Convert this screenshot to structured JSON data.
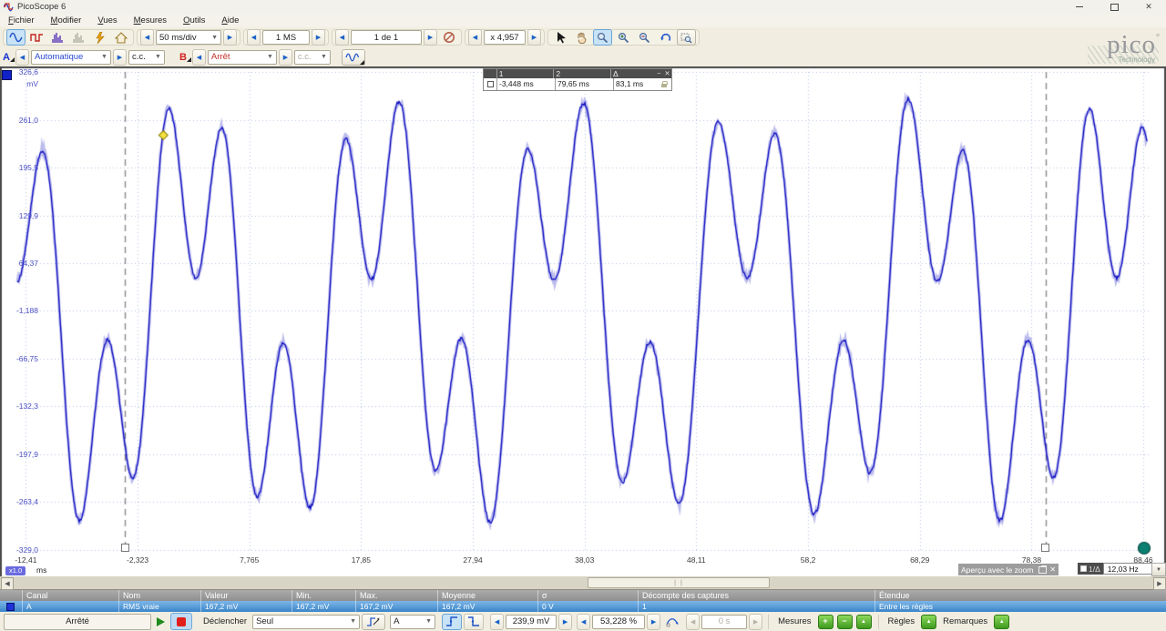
{
  "window": {
    "title": "PicoScope 6"
  },
  "menu": {
    "items": [
      "Fichier",
      "Modifier",
      "Vues",
      "Mesures",
      "Outils",
      "Aide"
    ]
  },
  "toolbar": {
    "timebase": "50 ms/div",
    "sample_count": "1 MS",
    "buffer_position": "1 de 1",
    "zoom_factor": "x 4,957"
  },
  "channel_bar": {
    "a_label": "A",
    "a_range": "Automatique",
    "a_coupling": "c.c.",
    "b_label": "B",
    "b_range": "Arrêt",
    "b_coupling": "c.c."
  },
  "logo": {
    "brand": "pico",
    "sub": "Technology"
  },
  "scope": {
    "y_axis_unit": "mV",
    "x_axis_unit": "ms",
    "x_scale_badge": "x1.0",
    "ruler_legend": {
      "headers": [
        "1",
        "2",
        "Δ"
      ],
      "values": [
        "-3,448 ms",
        "79,65 ms",
        "83,1 ms"
      ]
    },
    "overview_hint": "Aperçu avec le zoom",
    "freq_label": "1/Δ",
    "freq_value": "12,03 Hz"
  },
  "chart_data": {
    "type": "line",
    "title": "Channel A oscilloscope trace",
    "xlabel": "ms",
    "ylabel": "mV",
    "x_range_ms": [
      -12.41,
      88.46
    ],
    "y_range_mv": [
      -329.0,
      326.6
    ],
    "x_ticks": [
      -12.41,
      -2.323,
      7.765,
      17.85,
      27.94,
      38.03,
      48.11,
      58.2,
      68.29,
      78.38,
      88.46
    ],
    "y_ticks": [
      326.6,
      261.0,
      195.5,
      129.9,
      64.37,
      -1.188,
      -66.75,
      -132.3,
      -197.9,
      -263.4,
      -329.0
    ],
    "x_tick_labels": [
      "-12,41",
      "-2,323",
      "7,765",
      "17,85",
      "27,94",
      "38,03",
      "48,11",
      "58,2",
      "68,29",
      "78,38",
      "88,46"
    ],
    "y_tick_labels": [
      "326,6",
      "261,0",
      "195,5",
      "129,9",
      "64,37",
      "-1,188",
      "-66,75",
      "-132,3",
      "-197,9",
      "-263,4",
      "-329,0"
    ],
    "trace_color": "#0a0ac0",
    "grid_color": "#b6c4e6",
    "signal_model": {
      "fundamental_period_ms": 16.62,
      "fundamental_amp_mv": 195,
      "harmonic3_amp_mv": 150,
      "phase_ms": 1.481,
      "harmonic_drift_rad": 0.7,
      "drift_period_ms": 83.1,
      "noise_mv": 4
    },
    "time_rulers_ms": [
      -3.448,
      79.65
    ],
    "ruler_delta_ms": 83.1,
    "ruler_frequency_hz": 12.03,
    "trigger_marker": {
      "time_ms": 0,
      "level_mv": 239.9
    },
    "displayed_rms_mv": 167.2
  },
  "measurements": {
    "headers": [
      "Canal",
      "Nom",
      "Valeur",
      "Min.",
      "Max.",
      "Moyenne",
      "σ",
      "Décompte des captures",
      "Étendue"
    ],
    "rows": [
      {
        "channel": "A",
        "name": "RMS vraie",
        "value": "167,2 mV",
        "min": "167,2 mV",
        "max": "167,2 mV",
        "mean": "167,2 mV",
        "sigma": "0 V",
        "capture_count": "1",
        "scope": "Entre les règles"
      }
    ]
  },
  "bottom_bar": {
    "status": "Arrêté",
    "trigger_label": "Déclencher",
    "trigger_mode": "Seul",
    "trigger_source": "A",
    "trigger_level": "239,9 mV",
    "pre_trigger": "53,228 %",
    "delay": "0 s",
    "measures_label": "Mesures",
    "rulers_label": "Règles",
    "notes_label": "Remarques"
  },
  "colors": {
    "channel_a": "#1430d0",
    "channel_b": "#d02020",
    "selected_button": "#c8e2f6",
    "teal_marker": "#0b7f72",
    "trigger_yellow": "#f2e13e",
    "ruler_gray": "#8a8a8a"
  }
}
